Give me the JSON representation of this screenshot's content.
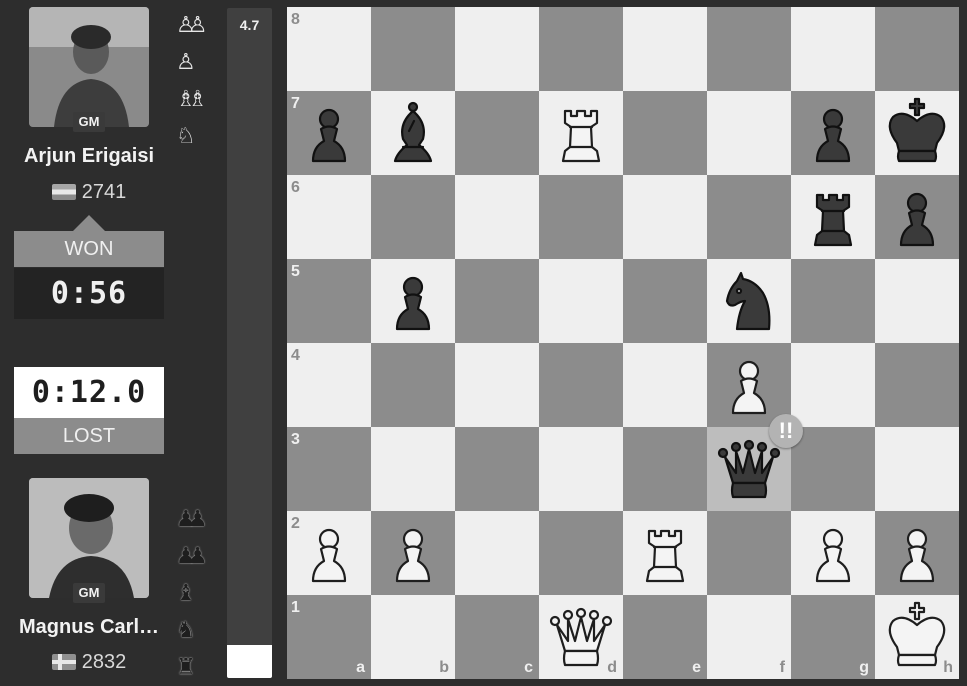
{
  "top_player": {
    "name": "Arjun Erigaisi",
    "title": "GM",
    "rating": "2741",
    "flag": "india-flag-icon",
    "result": "WON",
    "clock": "0:56",
    "captured": [
      "white-pawn-pair-icon",
      "white-pawn-icon",
      "white-bishop-pair-icon",
      "white-knight-icon"
    ]
  },
  "bottom_player": {
    "name": "Magnus Carl…",
    "title": "GM",
    "rating": "2832",
    "flag": "norway-flag-icon",
    "result": "LOST",
    "clock": "0:12.0",
    "captured": [
      "black-pawn-pair-icon",
      "black-pawn-pair-icon",
      "black-bishop-icon",
      "black-knight-icon",
      "black-rook-icon"
    ]
  },
  "eval": {
    "label": "4.7",
    "white_fraction": 0.05
  },
  "board": {
    "orientation": "white-bottom",
    "ranks": [
      "8",
      "7",
      "6",
      "5",
      "4",
      "3",
      "2",
      "1"
    ],
    "files": [
      "a",
      "b",
      "c",
      "d",
      "e",
      "f",
      "g",
      "h"
    ],
    "pieces": [
      {
        "square": "a7",
        "piece": "black-pawn"
      },
      {
        "square": "b7",
        "piece": "black-bishop"
      },
      {
        "square": "d7",
        "piece": "white-rook"
      },
      {
        "square": "g7",
        "piece": "black-pawn"
      },
      {
        "square": "h7",
        "piece": "black-king"
      },
      {
        "square": "g6",
        "piece": "black-rook"
      },
      {
        "square": "h6",
        "piece": "black-pawn"
      },
      {
        "square": "b5",
        "piece": "black-pawn"
      },
      {
        "square": "f5",
        "piece": "black-knight"
      },
      {
        "square": "f4",
        "piece": "white-pawn"
      },
      {
        "square": "f3",
        "piece": "black-queen"
      },
      {
        "square": "a2",
        "piece": "white-pawn"
      },
      {
        "square": "b2",
        "piece": "white-pawn"
      },
      {
        "square": "e2",
        "piece": "white-rook"
      },
      {
        "square": "g2",
        "piece": "white-pawn"
      },
      {
        "square": "h2",
        "piece": "white-pawn"
      },
      {
        "square": "d1",
        "piece": "white-queen"
      },
      {
        "square": "h1",
        "piece": "white-king"
      }
    ],
    "highlight": "f3",
    "move_annotation": {
      "square": "f3",
      "symbol": "!!"
    },
    "colors": {
      "light": "#efefef",
      "dark": "#8c8c8c",
      "highlight": "#bdbdbd"
    }
  }
}
